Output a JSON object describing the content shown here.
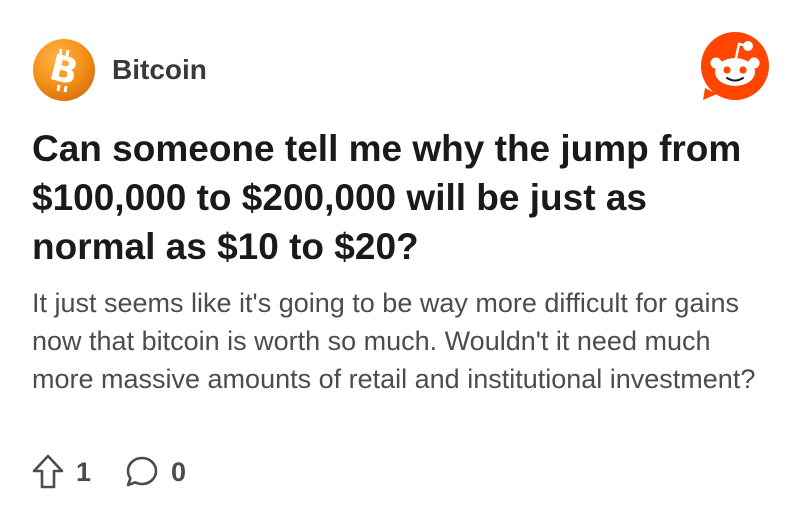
{
  "community": {
    "name": "Bitcoin",
    "icon": "bitcoin-logo-icon",
    "icon_color": "#f7931a"
  },
  "brand": {
    "icon": "reddit-logo-icon",
    "color": "#ff4500"
  },
  "post": {
    "title": "Can someone tell me why the jump from $100,000 to $200,000 will be just as normal as $10 to $20?",
    "body": "It just seems like it's going to be way more difficult for gains now that bitcoin is worth so much. Wouldn't it need much more massive amounts of retail and institutional investment?"
  },
  "actions": {
    "upvote": {
      "icon": "upvote-arrow-icon",
      "count": "1"
    },
    "comments": {
      "icon": "comment-bubble-icon",
      "count": "0"
    }
  }
}
